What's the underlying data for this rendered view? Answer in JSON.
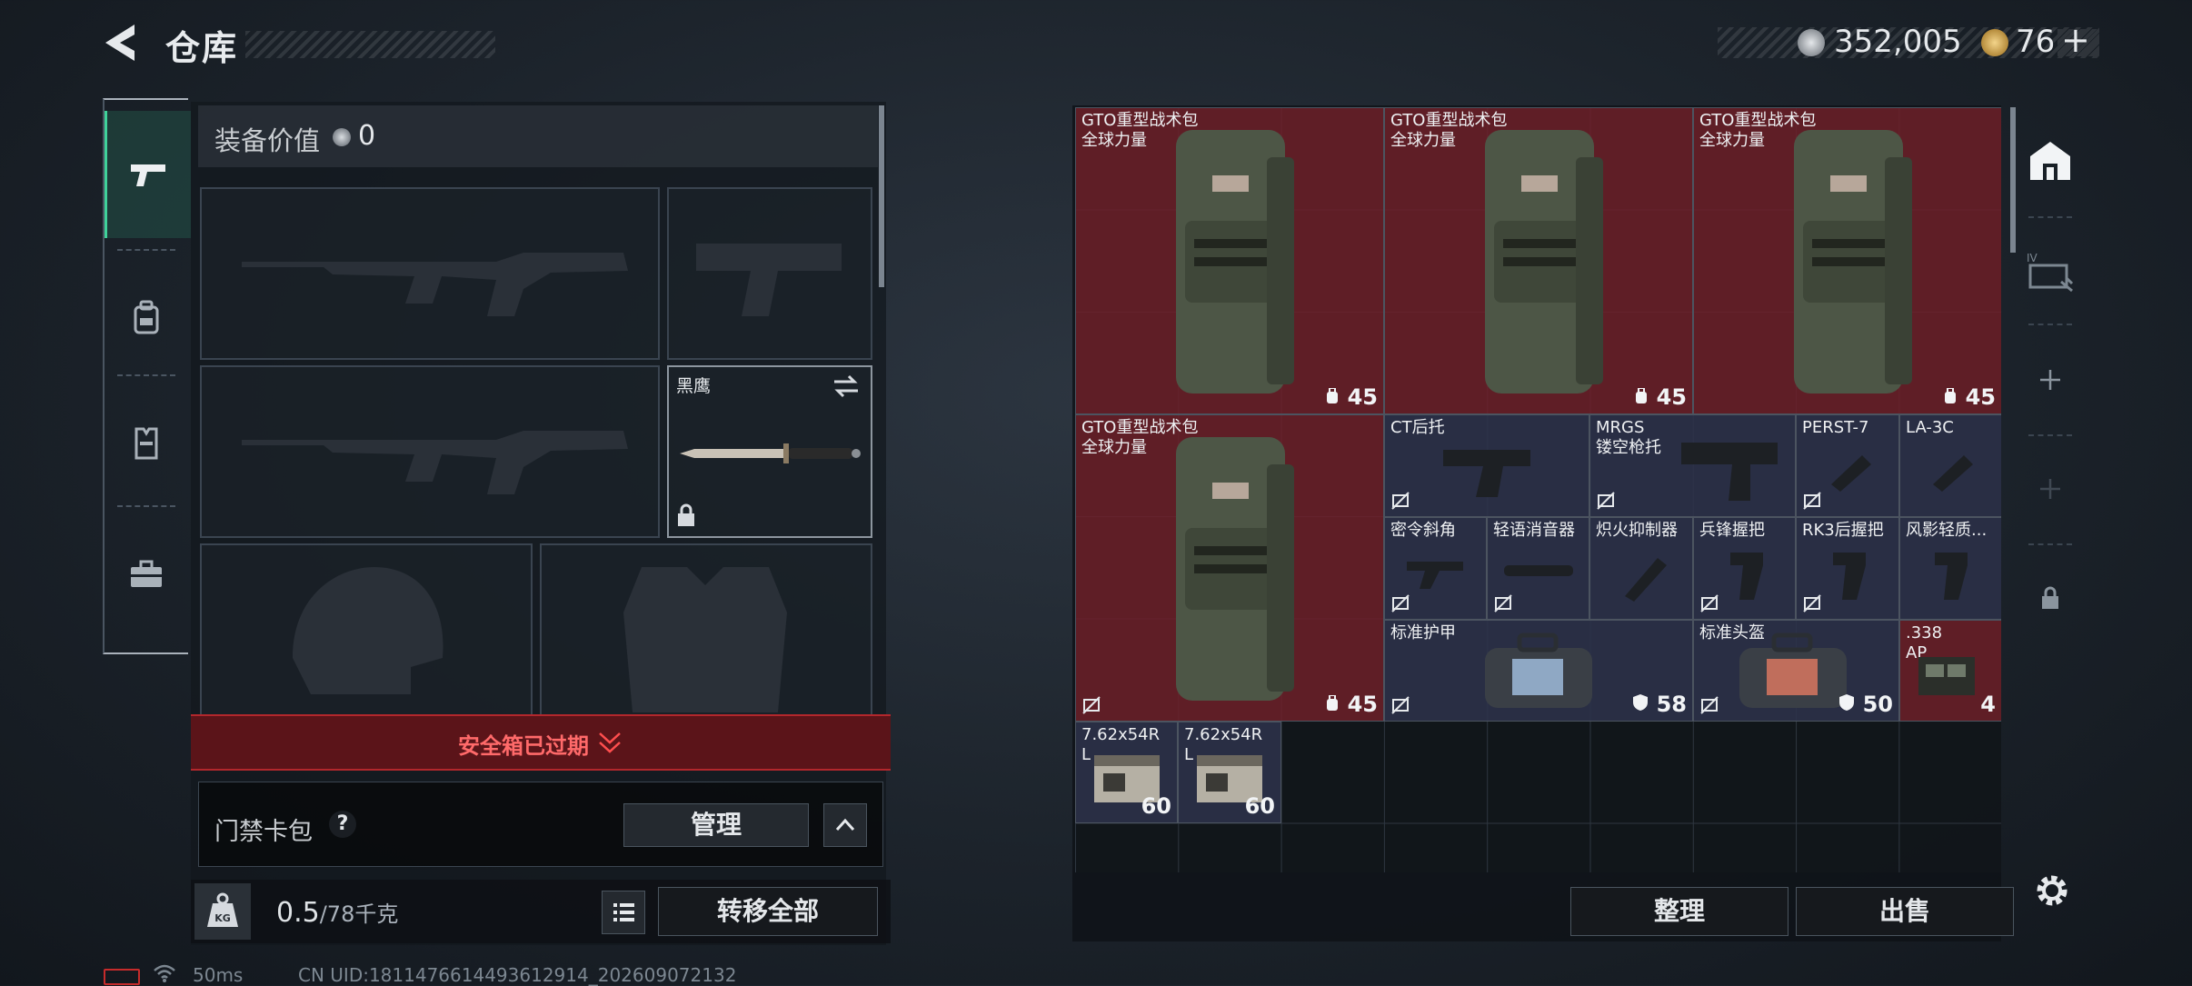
{
  "header": {
    "title": "仓库",
    "currency": "352,005",
    "premium": "76",
    "premium_plus": "+"
  },
  "sidebar": {
    "tabs": [
      "weapons",
      "backpack",
      "vest",
      "toolbox"
    ]
  },
  "equipment": {
    "value_label": "装备价值",
    "value": "0",
    "knife_name": "黑鹰",
    "safebox_status": "安全箱已过期"
  },
  "keycard": {
    "label": "门禁卡包",
    "help": "?",
    "manage": "管理"
  },
  "footer": {
    "weight": "0.5",
    "weight_max": "/78千克",
    "transfer_all": "转移全部"
  },
  "status": {
    "ping": "50ms",
    "uid": "CN UID:1811476614493612914_202609072132"
  },
  "warehouse": {
    "items": [
      {
        "name": "GTO重型战术包",
        "sub": "全球力量",
        "count": "45"
      },
      {
        "name": "GTO重型战术包",
        "sub": "全球力量",
        "count": "45"
      },
      {
        "name": "GTO重型战术包",
        "sub": "全球力量",
        "count": "45"
      },
      {
        "name": "GTO重型战术包",
        "sub": "全球力量",
        "count": "45"
      },
      {
        "name": "CT后托"
      },
      {
        "name": "MRGS",
        "sub": "镂空枪托"
      },
      {
        "name": "PERST-7"
      },
      {
        "name": "LA-3C"
      },
      {
        "name": "密令斜角"
      },
      {
        "name": "轻语消音器"
      },
      {
        "name": "炽火抑制器"
      },
      {
        "name": "兵锋握把"
      },
      {
        "name": "RK3后握把"
      },
      {
        "name": "风影轻质..."
      },
      {
        "name": "标准护甲",
        "count": "58"
      },
      {
        "name": "标准头盔",
        "count": "50"
      },
      {
        "name": ".338",
        "sub": "AP",
        "count": "4"
      },
      {
        "name": "7.62x54R",
        "sub": "L",
        "count": "60"
      },
      {
        "name": "7.62x54R",
        "sub": "L",
        "count": "60"
      }
    ],
    "sort": "整理",
    "sell": "出售"
  },
  "colors": {
    "accent_green": "#3fd29a",
    "danger_red": "#b2272c",
    "item_red": "#70202a",
    "item_blue": "#2c324a"
  }
}
